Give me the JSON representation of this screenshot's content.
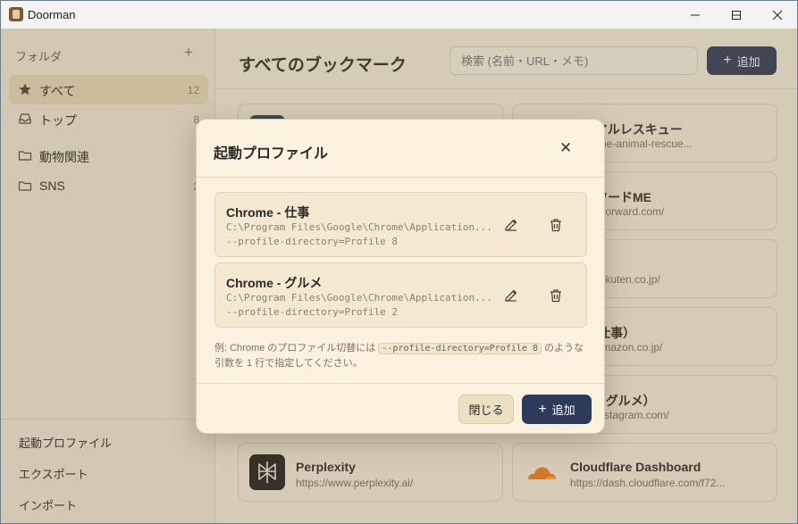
{
  "window": {
    "title": "Doorman",
    "controls": [
      "minimize",
      "maximize",
      "close"
    ]
  },
  "sidebar": {
    "folder_header": "フォルダ",
    "folder_add": "+",
    "items": [
      {
        "label": "すべて",
        "count": "12",
        "icon": "star-icon"
      },
      {
        "label": "トップ",
        "count": "8",
        "icon": "inbox-icon"
      },
      {
        "label": "動物関連",
        "count": "",
        "icon": "folder-icon"
      },
      {
        "label": "SNS",
        "count": "2",
        "icon": "folder-icon"
      }
    ],
    "bottom": [
      "起動プロファイル",
      "エクスポート",
      "インポート"
    ]
  },
  "main": {
    "title": "すべてのブックマーク",
    "search_placeholder": "検索 (名前・URL・メモ)",
    "add_label": "追加",
    "cards": [
      {
        "title": "",
        "url": ""
      },
      {
        "title": "アニマルレスキュー",
        "url": "www.libe-animal-rescue..."
      },
      {
        "title": "",
        "url": ""
      },
      {
        "title": "フォワードME",
        "url": "moneyforward.com/"
      },
      {
        "title": "",
        "url": ""
      },
      {
        "title": "場",
        "url": "www.rakuten.co.jp/"
      },
      {
        "title": "",
        "url": ""
      },
      {
        "title": "on（仕事）",
        "url": "www.amazon.co.jp/"
      },
      {
        "title": "",
        "url": ""
      },
      {
        "title": "ram（グルメ）",
        "url": "www.instagram.com/"
      },
      {
        "title": "Perplexity",
        "url": "https://www.perplexity.ai/"
      },
      {
        "title": "Cloudflare Dashboard",
        "url": "https://dash.cloudflare.com/f72..."
      }
    ]
  },
  "modal": {
    "title": "起動プロファイル",
    "close_symbol": "✕",
    "profiles": [
      {
        "name": "Chrome - 仕事",
        "path": "C:\\Program Files\\Google\\Chrome\\Application...",
        "args": "--profile-directory=Profile 8"
      },
      {
        "name": "Chrome - グルメ",
        "path": "C:\\Program Files\\Google\\Chrome\\Application...",
        "args": "--profile-directory=Profile 2"
      }
    ],
    "hint_prefix": "例: Chrome のプロファイル切替には",
    "hint_code": "--profile-directory=Profile 8",
    "hint_suffix": "のような",
    "hint_line2": "引数を 1 行で指定してください。",
    "close_button": "閉じる",
    "add_button": "追加"
  },
  "colors": {
    "accent": "#2e3a59",
    "background": "#faf4e5",
    "active_nav": "#eadfbf"
  }
}
